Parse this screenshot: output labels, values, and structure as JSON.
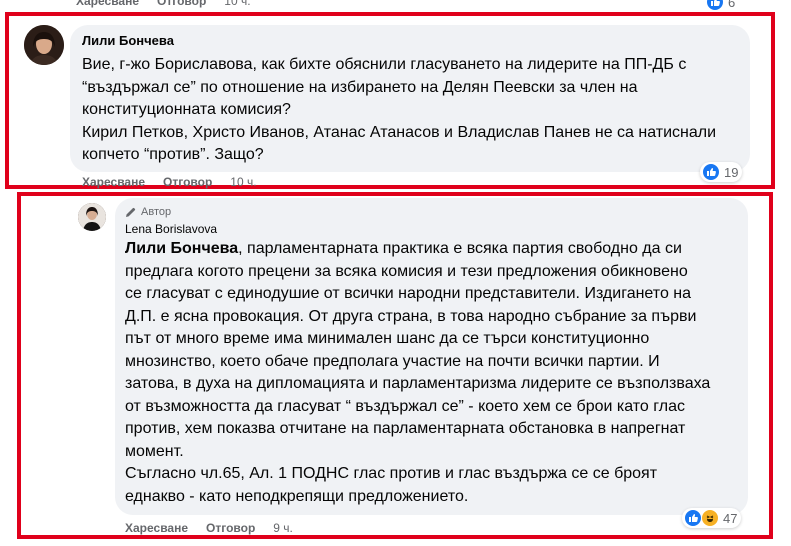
{
  "top_partial": {
    "like": "Харесване",
    "reply": "Отговор",
    "time": "10 ч.",
    "count": "6"
  },
  "comment1": {
    "author": "Лили Бончева",
    "lines": [
      "Вие, г-жо Бориславова, как бихте обяснили гласуването на лидерите на ПП-ДБ с",
      "“въздържал се” по отношение на избирането на Делян Пеевски за член на",
      "конституционната комисия?",
      "Кирил Петков, Христо Иванов, Атанас Атанасов и Владислав Панев не са натиснали",
      "копчето “против”. Защо?"
    ],
    "like": "Харесване",
    "reply": "Отговор",
    "time": "10 ч.",
    "reaction_count": "19"
  },
  "comment2": {
    "badge": "Автор",
    "author": "Lena Borislavova",
    "mention": "Лили Бончева",
    "first_line_rest": ", парламентарната практика е всяка партия свободно да си",
    "lines": [
      "предлага когото прецени за всяка комисия и тези предложения обикновено",
      "се гласуват с единодушие от всички народни представители. Издигането на",
      "Д.П. е ясна провокация. От друга страна, в това народно събрание за първи",
      "път от много време има минимален шанс да се търси конституционно",
      "мнозинство, което обаче предполага участие на почти всички партии. И",
      "затова, в духа на дипломацията и парламентаризма лидерите се възползваха",
      "от възможността да гласуват “ въздържал се” - което хем се брои като глас",
      "против, хем показва отчитане на парламентарната обстановка в напрегнат",
      "момент.",
      "Съгласно чл.65, Ал. 1 ПОДНС глас против и глас въздържа се се броят",
      "еднакво - като неподкрепящи предложението."
    ],
    "like": "Харесване",
    "reply": "Отговор",
    "time": "9 ч.",
    "reaction_count": "47"
  },
  "colors": {
    "highlight": "#e0001b",
    "bubble": "#f0f2f5",
    "like_blue": "#1877f2",
    "secondary_text": "#65676b"
  },
  "icons": [
    "like-icon",
    "haha-icon",
    "pencil-icon",
    "avatar"
  ]
}
